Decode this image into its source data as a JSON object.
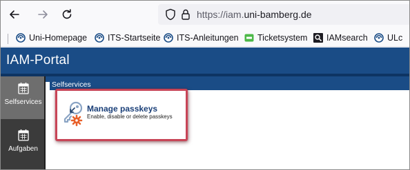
{
  "browser": {
    "url_prefix": "https://iam.",
    "url_domain": "uni-bamberg.de"
  },
  "bookmarks": [
    {
      "label": "Uni-Homepage",
      "icon": "uni-swirl-icon"
    },
    {
      "label": "ITS-Startseite",
      "icon": "uni-swirl-icon"
    },
    {
      "label": "ITS-Anleitungen",
      "icon": "uni-swirl-icon"
    },
    {
      "label": "Ticketsystem",
      "icon": "ticketsystem-icon"
    },
    {
      "label": "IAMsearch",
      "icon": "search-icon"
    },
    {
      "label": "ULc",
      "icon": "uni-swirl-icon"
    }
  ],
  "portal": {
    "title": "IAM-Portal"
  },
  "sidebar": {
    "items": [
      {
        "label": "Selfservices",
        "icon": "calendar-icon",
        "active": true
      },
      {
        "label": "Aufgaben",
        "icon": "calendar-icon",
        "active": false
      }
    ]
  },
  "main": {
    "section_title": "Selfservices",
    "card": {
      "title": "Manage passkeys",
      "description": "Enable, disable or delete passkeys"
    }
  },
  "colors": {
    "header_blue": "#1a4c86",
    "sidebar_dark": "#3b3b3b",
    "sidebar_active": "#6e6e6e",
    "highlight_red": "#c84557",
    "card_title": "#1a3f78"
  }
}
